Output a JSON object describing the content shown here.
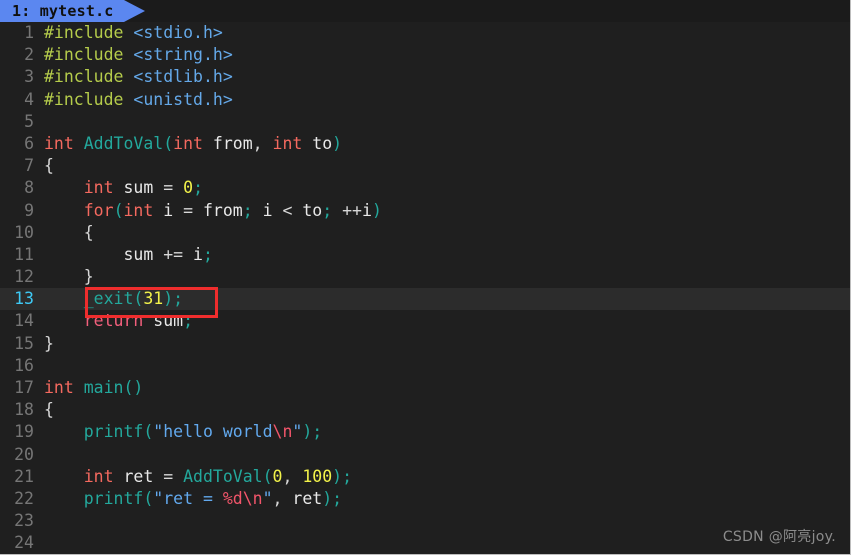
{
  "tab": {
    "label": "1: mytest.c",
    "index": "1",
    "filename": "mytest.c",
    "active_color": "#5b87f0",
    "text_color": "#10100f"
  },
  "editor": {
    "background": "#1f1f1f",
    "current_line_number": "13",
    "current_line_highlight": "#2c2c2c",
    "gutter_color": "#767676",
    "current_gutter_color": "#3ec9f5",
    "total_lines": 24
  },
  "annotation": {
    "type": "rectangle",
    "color": "#ef2d2d",
    "target_line": "13",
    "target_text": "_exit(31);"
  },
  "watermark": {
    "text": "CSDN @阿亮joy.",
    "color": "#8c8c8c"
  },
  "lines": [
    {
      "n": "1",
      "text": "#include <stdio.h>"
    },
    {
      "n": "2",
      "text": "#include <string.h>"
    },
    {
      "n": "3",
      "text": "#include <stdlib.h>"
    },
    {
      "n": "4",
      "text": "#include <unistd.h>"
    },
    {
      "n": "5",
      "text": ""
    },
    {
      "n": "6",
      "text": "int AddToVal(int from, int to)"
    },
    {
      "n": "7",
      "text": "{"
    },
    {
      "n": "8",
      "text": "    int sum = 0;"
    },
    {
      "n": "9",
      "text": "    for(int i = from; i < to; ++i)"
    },
    {
      "n": "10",
      "text": "    {"
    },
    {
      "n": "11",
      "text": "        sum += i;"
    },
    {
      "n": "12",
      "text": "    }"
    },
    {
      "n": "13",
      "text": "    _exit(31);"
    },
    {
      "n": "14",
      "text": "    return sum;"
    },
    {
      "n": "15",
      "text": "}"
    },
    {
      "n": "16",
      "text": ""
    },
    {
      "n": "17",
      "text": "int main()"
    },
    {
      "n": "18",
      "text": "{"
    },
    {
      "n": "19",
      "text": "    printf(\"hello world\\n\");"
    },
    {
      "n": "20",
      "text": ""
    },
    {
      "n": "21",
      "text": "    int ret = AddToVal(0, 100);"
    },
    {
      "n": "22",
      "text": "    printf(\"ret = %d\\n\", ret);"
    },
    {
      "n": "23",
      "text": ""
    },
    {
      "n": "24",
      "text": ""
    }
  ]
}
